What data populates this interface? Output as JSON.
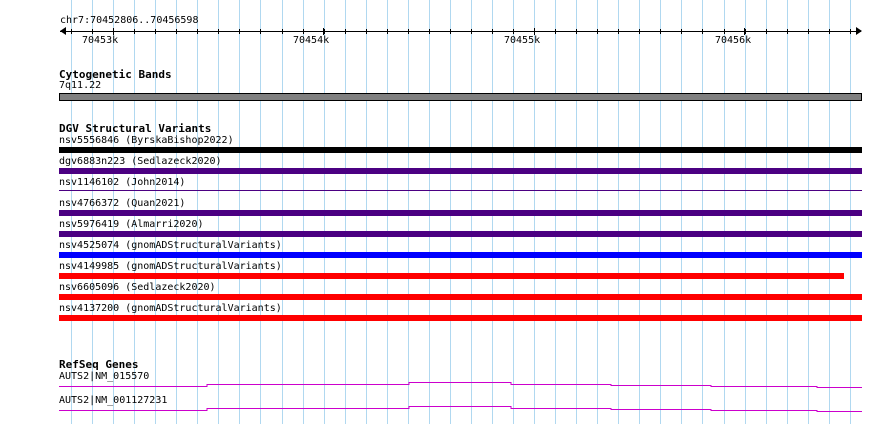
{
  "ruler": {
    "location": "chr7:70452806..70456598",
    "ticks": [
      "70453k",
      "70454k",
      "70455k",
      "70456k"
    ]
  },
  "cytogenetic": {
    "title": "Cytogenetic Bands",
    "band_label": "7q11.22",
    "band_color": "#808080"
  },
  "dgv": {
    "title": "DGV Structural Variants",
    "variants": [
      {
        "label": "nsv5556846 (ByrskaBishop2022)",
        "color": "#000000"
      },
      {
        "label": "dgv6883n223 (Sedlazeck2020)",
        "color": "#4b0082"
      },
      {
        "label": "nsv1146102 (John2014)",
        "color": "#4b0082"
      },
      {
        "label": "nsv4766372 (Quan2021)",
        "color": "#4b0082"
      },
      {
        "label": "nsv5976419 (Almarri2020)",
        "color": "#4b0082"
      },
      {
        "label": "nsv4525074 (gnomADStructuralVariants)",
        "color": "#0000ff"
      },
      {
        "label": "nsv4149985 (gnomADStructuralVariants)",
        "color": "#ff0000"
      },
      {
        "label": "nsv6605096 (Sedlazeck2020)",
        "color": "#ff0000"
      },
      {
        "label": "nsv4137200 (gnomADStructuralVariants)",
        "color": "#ff0000"
      }
    ]
  },
  "refseq": {
    "title": "RefSeq Genes",
    "genes": [
      {
        "label": "AUTS2|NM_015570",
        "color": "#cc00cc"
      },
      {
        "label": "AUTS2|NM_001127231",
        "color": "#cc00cc"
      }
    ]
  },
  "grid_color": "#b0d8f0"
}
